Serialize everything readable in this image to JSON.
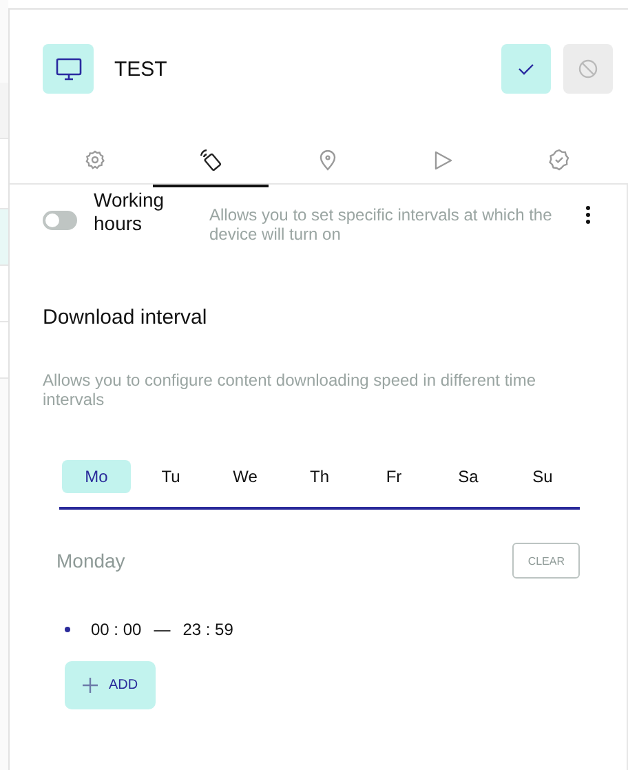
{
  "device": {
    "name": "TEST"
  },
  "header_actions": [
    {
      "kind": "confirm",
      "disabled": false
    },
    {
      "kind": "block",
      "disabled": true
    }
  ],
  "tabs": [
    {
      "kind": "settings",
      "selected": false
    },
    {
      "kind": "remote",
      "selected": true
    },
    {
      "kind": "location",
      "selected": false
    },
    {
      "kind": "play",
      "selected": false
    },
    {
      "kind": "verified",
      "selected": false
    }
  ],
  "working_hours": {
    "label": "Working hours",
    "on": false,
    "description": "Allows you to set specific intervals at which the device will turn on"
  },
  "download_interval": {
    "title": "Download interval",
    "description": "Allows you to configure content downloading speed in different time intervals",
    "days": [
      {
        "label": "Mo",
        "selected": true
      },
      {
        "label": "Tu",
        "selected": false
      },
      {
        "label": "We",
        "selected": false
      },
      {
        "label": "Th",
        "selected": false
      },
      {
        "label": "Fr",
        "selected": false
      },
      {
        "label": "Sa",
        "selected": false
      },
      {
        "label": "Su",
        "selected": false
      }
    ],
    "day_title": "Monday",
    "clear_label": "CLEAR",
    "intervals": [
      {
        "start": "00 : 00",
        "separator": "—",
        "end": "23 : 59"
      }
    ],
    "add_label": "ADD"
  }
}
